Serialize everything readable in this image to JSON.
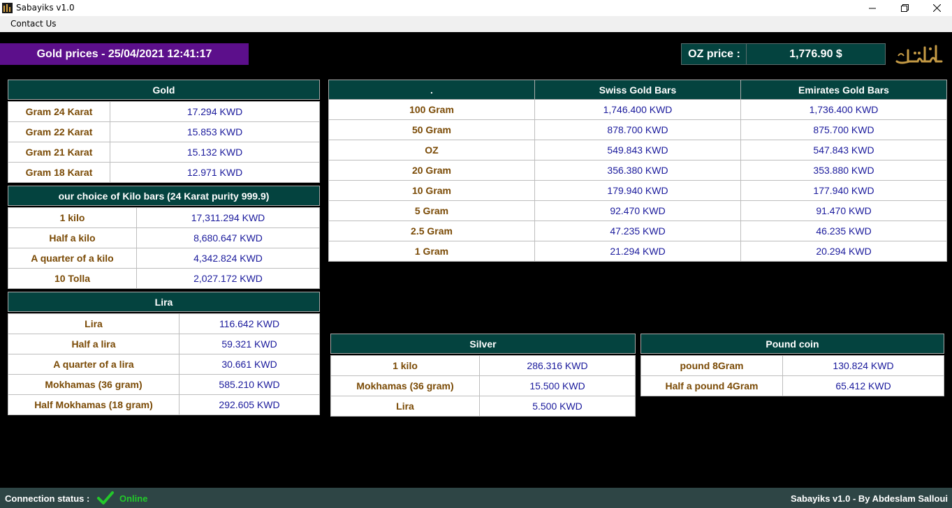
{
  "window": {
    "title": "Sabayiks v1.0"
  },
  "menu": {
    "contact": "Contact Us"
  },
  "header": {
    "title": "Gold prices - 25/04/2021 12:41:17",
    "oz_label": "OZ price :",
    "oz_value": "1,776.90 $"
  },
  "gold": {
    "title": "Gold",
    "rows": [
      {
        "label": "Gram 24 Karat",
        "value": "17.294  KWD"
      },
      {
        "label": "Gram 22 Karat",
        "value": "15.853  KWD"
      },
      {
        "label": "Gram 21 Karat",
        "value": "15.132  KWD"
      },
      {
        "label": "Gram 18 Karat",
        "value": "12.971  KWD"
      }
    ]
  },
  "kilo": {
    "title": "our choice of Kilo bars (24 Karat purity 999.9)",
    "rows": [
      {
        "label": "1 kilo",
        "value": "17,311.294  KWD"
      },
      {
        "label": "Half a kilo",
        "value": "8,680.647  KWD"
      },
      {
        "label": "A quarter of a kilo",
        "value": "4,342.824  KWD"
      },
      {
        "label": "10 Tolla",
        "value": "2,027.172  KWD"
      }
    ]
  },
  "lira": {
    "title": "Lira",
    "rows": [
      {
        "label": "Lira",
        "value": "116.642  KWD"
      },
      {
        "label": "Half a lira",
        "value": "59.321  KWD"
      },
      {
        "label": "A quarter of a lira",
        "value": "30.661  KWD"
      },
      {
        "label": "Mokhamas (36 gram)",
        "value": "585.210  KWD"
      },
      {
        "label": "Half Mokhamas (18 gram)",
        "value": "292.605  KWD"
      }
    ]
  },
  "bars": {
    "headers": [
      ".",
      "Swiss Gold Bars",
      "Emirates Gold Bars"
    ],
    "rows": [
      {
        "label": "100 Gram",
        "swiss": "1,746.400  KWD",
        "emirates": "1,736.400  KWD"
      },
      {
        "label": "50 Gram",
        "swiss": "878.700  KWD",
        "emirates": "875.700  KWD"
      },
      {
        "label": "OZ",
        "swiss": "549.843  KWD",
        "emirates": "547.843  KWD"
      },
      {
        "label": "20 Gram",
        "swiss": "356.380  KWD",
        "emirates": "353.880  KWD"
      },
      {
        "label": "10 Gram",
        "swiss": "179.940  KWD",
        "emirates": "177.940  KWD"
      },
      {
        "label": "5 Gram",
        "swiss": "92.470  KWD",
        "emirates": "91.470  KWD"
      },
      {
        "label": "2.5 Gram",
        "swiss": "47.235  KWD",
        "emirates": "46.235  KWD"
      },
      {
        "label": "1 Gram",
        "swiss": "21.294  KWD",
        "emirates": "20.294  KWD"
      }
    ]
  },
  "silver": {
    "title": "Silver",
    "rows": [
      {
        "label": "1 kilo",
        "value": "286.316  KWD"
      },
      {
        "label": "Mokhamas (36 gram)",
        "value": "15.500  KWD"
      },
      {
        "label": "Lira",
        "value": "5.500  KWD"
      }
    ]
  },
  "pound": {
    "title": "Pound coin",
    "rows": [
      {
        "label": "pound 8Gram",
        "value": "130.824  KWD"
      },
      {
        "label": "Half a pound 4Gram",
        "value": "65.412  KWD"
      }
    ]
  },
  "status": {
    "label": "Connection status :",
    "value": "Online",
    "footer": "Sabayiks v1.0 - By Abdeslam Salloui"
  },
  "colors": {
    "header_bg": "#5c0f8b",
    "table_header": "#04433f",
    "label": "#7a4a05",
    "value": "#1a1a9c",
    "online": "#23c92a",
    "status_bg": "#2e4545"
  },
  "icons": {
    "app": "gold-bars-icon",
    "minimize": "minimize-icon",
    "maximize": "maximize-icon",
    "close": "close-icon",
    "logo": "sabayiks-logo",
    "status": "check-icon"
  }
}
